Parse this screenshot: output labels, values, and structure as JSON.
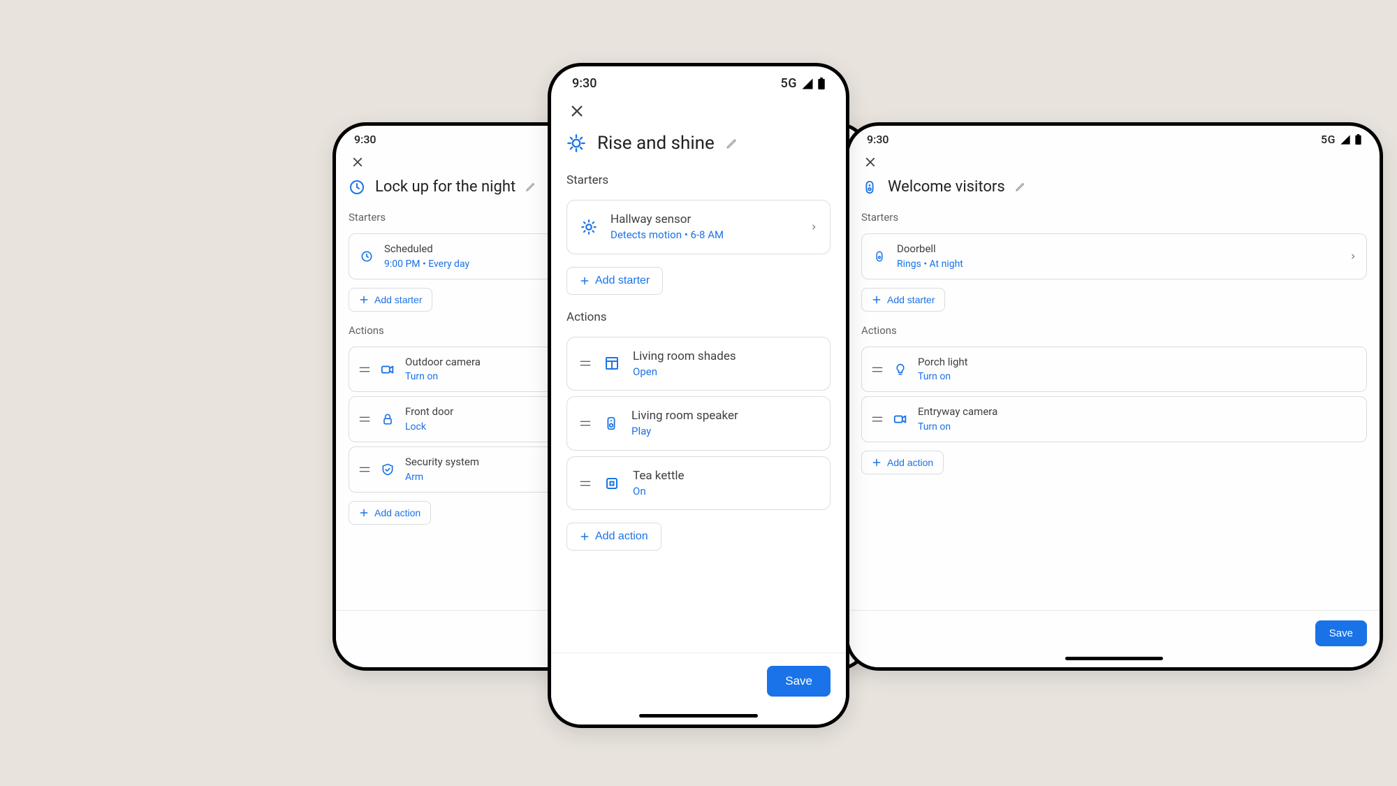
{
  "status": {
    "time": "9:30",
    "network": "5G"
  },
  "save_label": "Save",
  "add_starter_label": "Add starter",
  "add_action_label": "Add action",
  "starters_label": "Starters",
  "actions_label": "Actions",
  "left": {
    "title": "Lock up for the night",
    "starter": {
      "name": "Scheduled",
      "sub": "9:00 PM • Every day"
    },
    "actions": [
      {
        "name": "Outdoor camera",
        "sub": "Turn on"
      },
      {
        "name": "Front door",
        "sub": "Lock"
      },
      {
        "name": "Security system",
        "sub": "Arm"
      }
    ]
  },
  "center": {
    "title": "Rise and shine",
    "starter": {
      "name": "Hallway sensor",
      "sub": "Detects motion • 6-8 AM"
    },
    "actions": [
      {
        "name": "Living room shades",
        "sub": "Open"
      },
      {
        "name": "Living room speaker",
        "sub": "Play"
      },
      {
        "name": "Tea kettle",
        "sub": "On"
      }
    ]
  },
  "right": {
    "title": "Welcome visitors",
    "starter": {
      "name": "Doorbell",
      "sub": "Rings • At night"
    },
    "actions": [
      {
        "name": "Porch light",
        "sub": "Turn on"
      },
      {
        "name": "Entryway camera",
        "sub": "Turn on"
      }
    ]
  }
}
